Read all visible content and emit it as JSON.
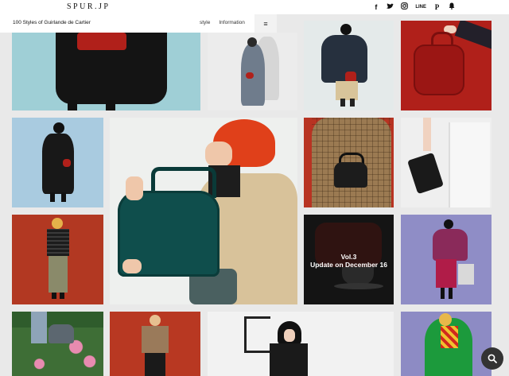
{
  "header": {
    "logo": "SPUR.JP",
    "social": {
      "facebook": "f",
      "twitter": "❧",
      "instagram": "◎",
      "line": "LINE",
      "pinterest": "P",
      "notification": "▲"
    }
  },
  "subnav": {
    "title": "100 Styles of Guirlande de Cartier",
    "links": [
      "style",
      "Information"
    ],
    "menu_glyph": "≡"
  },
  "promo": {
    "line1": "Vol.3",
    "line2": "Update on December 16"
  },
  "colors": {
    "accent_red": "#b0201a",
    "bag_green": "#0f4e4c",
    "dark": "#1a1a1a"
  },
  "search": {
    "icon": "search-icon"
  }
}
